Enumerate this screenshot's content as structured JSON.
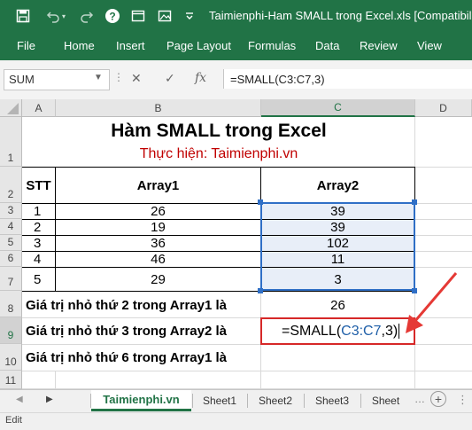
{
  "window": {
    "title": "Taimienphi-Ham SMALL trong Excel.xls  [Compatibility"
  },
  "quick_access": [
    "save-icon",
    "undo-icon",
    "redo-icon",
    "help-icon",
    "window-icon",
    "minimize-icon"
  ],
  "ribbon": {
    "tabs": [
      "File",
      "Home",
      "Insert",
      "Page Layout",
      "Formulas",
      "Data",
      "Review",
      "View"
    ]
  },
  "formula_bar": {
    "name_box": "SUM",
    "cancel_symbol": "✕",
    "enter_symbol": "✓",
    "fx_symbol": "fx",
    "formula": "=SMALL(C3:C7,3)"
  },
  "columns": [
    "A",
    "B",
    "C",
    "D"
  ],
  "rows": [
    "1",
    "2",
    "3",
    "4",
    "5",
    "6",
    "7",
    "8",
    "9",
    "10",
    "11"
  ],
  "sheet": {
    "title": "Hàm SMALL trong Excel",
    "subtitle": "Thực hiện: Taimienphi.vn",
    "headers": {
      "stt": "STT",
      "array1": "Array1",
      "array2": "Array2"
    },
    "data_rows": [
      {
        "stt": "1",
        "array1": "26",
        "array2": "39"
      },
      {
        "stt": "2",
        "array1": "19",
        "array2": "39"
      },
      {
        "stt": "3",
        "array1": "36",
        "array2": "102"
      },
      {
        "stt": "4",
        "array1": "46",
        "array2": "11"
      },
      {
        "stt": "5",
        "array1": "29",
        "array2": "3"
      }
    ],
    "results": [
      {
        "label": "Giá trị nhỏ thứ 2 trong Array1 là",
        "value": "26"
      },
      {
        "label": "Giá trị nhỏ thứ 3 trong Array2 là",
        "value": ""
      },
      {
        "label": "Giá trị nhỏ thứ 6 trong Array1 là",
        "value": ""
      }
    ],
    "editing_cell": {
      "prefix": "=SMALL(",
      "ref": "C3:C7",
      "suffix": ",3)"
    }
  },
  "sheet_tabs": [
    "Taimienphi.vn",
    "Sheet1",
    "Sheet2",
    "Sheet3",
    "Sheet"
  ],
  "status": "Edit",
  "colors": {
    "excel_green": "#217346",
    "reference_blue": "#1f5fa8",
    "annotation_red": "#e53935",
    "subtitle_red": "#c00000"
  }
}
